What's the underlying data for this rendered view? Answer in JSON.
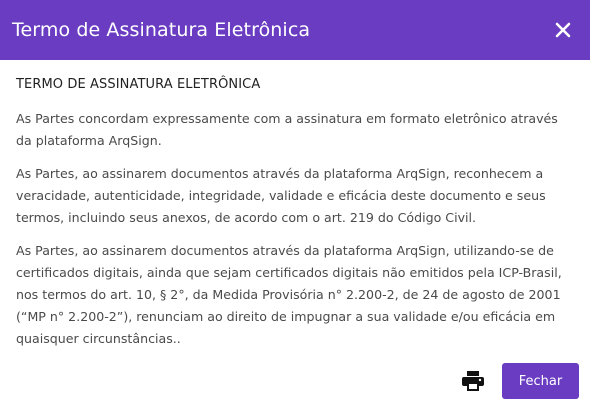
{
  "header": {
    "title": "Termo de Assinatura Eletrônica",
    "close_icon": "close-icon"
  },
  "body": {
    "heading": "TERMO DE ASSINATURA ELETRÔNICA",
    "paragraphs": [
      "As Partes concordam expressamente com a assinatura em formato eletrônico através da plataforma ArqSign.",
      "As Partes, ao assinarem documentos através da plataforma ArqSign, reconhecem a veracidade, autenticidade, integridade, validade e eficácia deste documento e seus termos, incluindo seus anexos, de acordo com o art. 219 do Código Civil.",
      "As Partes, ao assinarem documentos através da plataforma ArqSign, utilizando-se de certificados digitais, ainda que sejam certificados digitais não emitidos pela ICP-Brasil, nos termos do art. 10, § 2°, da Medida Provisória n° 2.200-2, de 24 de agosto de 2001 (“MP n° 2.200-2”), renunciam ao direito de impugnar a sua validade e/ou eficácia em quaisquer circunstâncias.."
    ]
  },
  "footer": {
    "print_icon": "print-icon",
    "close_button_label": "Fechar"
  },
  "colors": {
    "accent": "#6a3cc2",
    "text": "#4a4a4a",
    "heading_text": "#222222"
  }
}
